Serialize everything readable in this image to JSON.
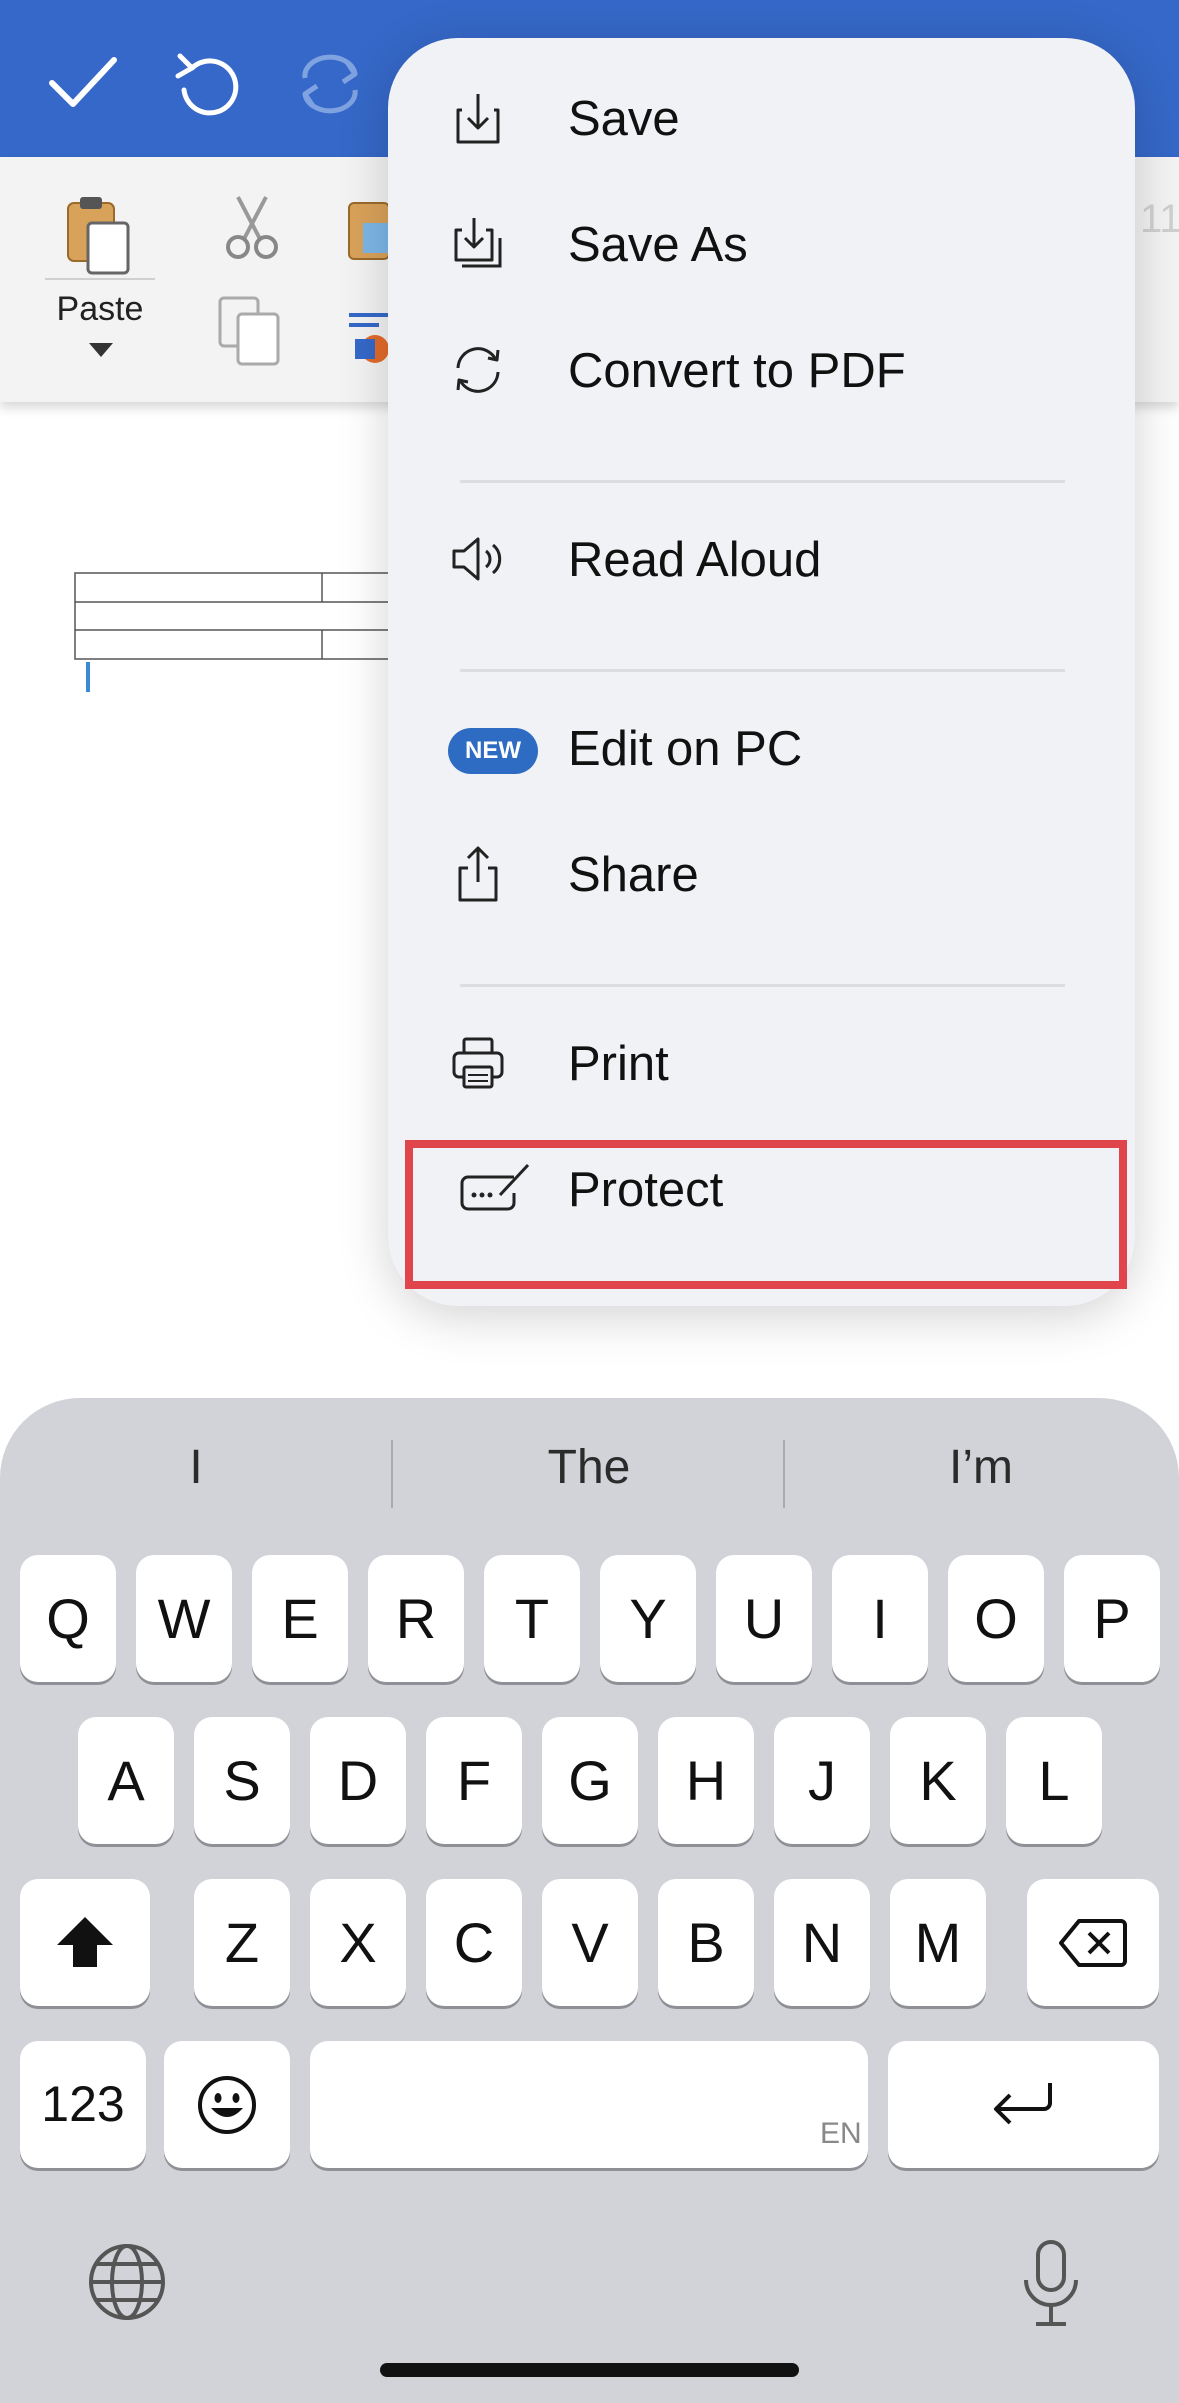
{
  "colors": {
    "topbar": "#3568c8",
    "highlight": "#e0454b",
    "new_badge": "#2e6cc4"
  },
  "toolbar": {
    "icons": [
      "checkmark-icon",
      "undo-icon",
      "redo-icon"
    ]
  },
  "ribbon": {
    "paste_label": "Paste",
    "ghost_text": "11"
  },
  "menu": {
    "items": [
      {
        "label": "Save",
        "icon": "save-icon"
      },
      {
        "label": "Save As",
        "icon": "save-as-icon"
      },
      {
        "label": "Convert to PDF",
        "icon": "convert-icon"
      },
      {
        "label": "Read Aloud",
        "icon": "speaker-icon"
      },
      {
        "label": "Edit on PC",
        "icon": "new-badge",
        "badge": "NEW"
      },
      {
        "label": "Share",
        "icon": "share-icon"
      },
      {
        "label": "Print",
        "icon": "printer-icon"
      },
      {
        "label": "Protect",
        "icon": "signature-icon",
        "highlighted": true
      }
    ]
  },
  "keyboard": {
    "suggestions": [
      "I",
      "The",
      "I’m"
    ],
    "row1": [
      "Q",
      "W",
      "E",
      "R",
      "T",
      "Y",
      "U",
      "I",
      "O",
      "P"
    ],
    "row2": [
      "A",
      "S",
      "D",
      "F",
      "G",
      "H",
      "J",
      "K",
      "L"
    ],
    "row3": [
      "Z",
      "X",
      "C",
      "V",
      "B",
      "N",
      "M"
    ],
    "numbers_key": "123",
    "language_hint": "EN"
  }
}
